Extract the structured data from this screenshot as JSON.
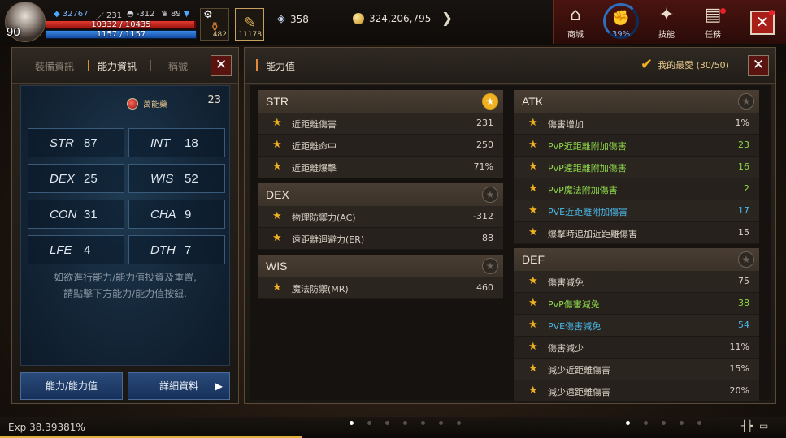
{
  "hud": {
    "level": "90",
    "blue_count": "32767",
    "sword_count": "231",
    "shield_count": "-312",
    "trophy_count": "89",
    "hp_text": "10332 / 10435",
    "hp_fraction": 0.99,
    "mp_text": "1157 / 1157",
    "mp_fraction": 1.0,
    "potion_count": "482",
    "scroll_count": "11178",
    "gem_count": "358",
    "gold": "324,206,795",
    "menu": {
      "shop": "商城",
      "stat_pct": "39%",
      "skill": "技能",
      "quest": "任務"
    }
  },
  "left_panel": {
    "tabs": [
      "裝備資訊",
      "能力資訊",
      "稱號"
    ],
    "elixir_label": "萬能藥",
    "elixir_count": "23",
    "stats": [
      {
        "name": "STR",
        "value": "87"
      },
      {
        "name": "INT",
        "value": "18"
      },
      {
        "name": "DEX",
        "value": "25"
      },
      {
        "name": "WIS",
        "value": "52"
      },
      {
        "name": "CON",
        "value": "31"
      },
      {
        "name": "CHA",
        "value": "9"
      },
      {
        "name": "LFE",
        "value": "4"
      },
      {
        "name": "DTH",
        "value": "7"
      }
    ],
    "hint_line1": "如欲進行能力/能力值投資及重置,",
    "hint_line2": "請點擊下方能力/能力值按鈕.",
    "btn_ability": "能力/能力值",
    "btn_detail": "詳細資料"
  },
  "right_panel": {
    "title": "能力值",
    "favorites": "我的最愛 (30/50)",
    "str": {
      "title": "STR",
      "rows": [
        {
          "label": "近距離傷害",
          "value": "231"
        },
        {
          "label": "近距離命中",
          "value": "250"
        },
        {
          "label": "近距離爆擊",
          "value": "71%"
        }
      ]
    },
    "dex": {
      "title": "DEX",
      "rows": [
        {
          "label": "物理防禦力(AC)",
          "value": "-312"
        },
        {
          "label": "遠距離迴避力(ER)",
          "value": "88"
        }
      ]
    },
    "wis": {
      "title": "WIS",
      "rows": [
        {
          "label": "魔法防禦(MR)",
          "value": "460"
        }
      ]
    },
    "atk": {
      "title": "ATK",
      "rows": [
        {
          "label": "傷害增加",
          "value": "1%"
        },
        {
          "label": "PvP近距離附加傷害",
          "value": "23"
        },
        {
          "label": "PvP遠距離附加傷害",
          "value": "16"
        },
        {
          "label": "PvP魔法附加傷害",
          "value": "2"
        },
        {
          "label": "PVE近距離附加傷害",
          "value": "17"
        },
        {
          "label": "爆擊時追加近距離傷害",
          "value": "15"
        }
      ]
    },
    "def": {
      "title": "DEF",
      "rows": [
        {
          "label": "傷害減免",
          "value": "75"
        },
        {
          "label": "PvP傷害減免",
          "value": "38"
        },
        {
          "label": "PVE傷害減免",
          "value": "54"
        },
        {
          "label": "傷害減少",
          "value": "11%"
        },
        {
          "label": "減少近距離傷害",
          "value": "15%"
        },
        {
          "label": "減少遠距離傷害",
          "value": "20%"
        }
      ]
    }
  },
  "exp": {
    "text": "Exp 38.39381%",
    "fraction": 0.3839
  }
}
